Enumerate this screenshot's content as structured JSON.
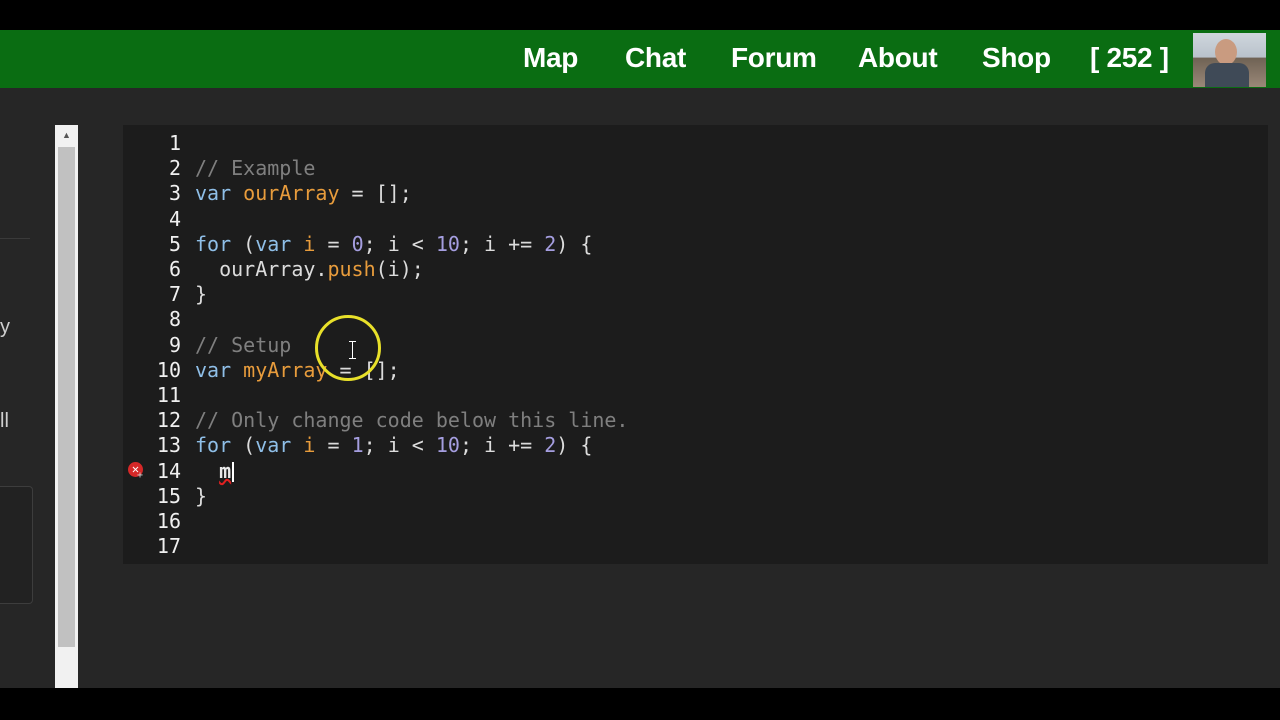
{
  "nav": {
    "links": [
      "Map",
      "Chat",
      "Forum",
      "About",
      "Shop"
    ],
    "points": "[ 252 ]"
  },
  "left_panel": {
    "char1": "y",
    "char2": "ll"
  },
  "editor": {
    "lines": [
      {
        "n": "1",
        "tokens": []
      },
      {
        "n": "2",
        "tokens": [
          {
            "t": "// Example",
            "k": "com"
          }
        ]
      },
      {
        "n": "3",
        "tokens": [
          {
            "t": "var",
            "k": "kw"
          },
          {
            "t": " ",
            "k": "pl"
          },
          {
            "t": "ourArray",
            "k": "var"
          },
          {
            "t": " = [];",
            "k": "pl"
          }
        ]
      },
      {
        "n": "4",
        "tokens": []
      },
      {
        "n": "5",
        "tokens": [
          {
            "t": "for",
            "k": "kw"
          },
          {
            "t": " (",
            "k": "pl"
          },
          {
            "t": "var",
            "k": "kw"
          },
          {
            "t": " ",
            "k": "pl"
          },
          {
            "t": "i",
            "k": "var"
          },
          {
            "t": " = ",
            "k": "pl"
          },
          {
            "t": "0",
            "k": "num"
          },
          {
            "t": "; i < ",
            "k": "pl"
          },
          {
            "t": "10",
            "k": "num"
          },
          {
            "t": "; i += ",
            "k": "pl"
          },
          {
            "t": "2",
            "k": "num"
          },
          {
            "t": ") {",
            "k": "pl"
          }
        ]
      },
      {
        "n": "6",
        "tokens": [
          {
            "t": "  ourArray.",
            "k": "pl"
          },
          {
            "t": "push",
            "k": "var"
          },
          {
            "t": "(i);",
            "k": "pl"
          }
        ]
      },
      {
        "n": "7",
        "tokens": [
          {
            "t": "}",
            "k": "pl"
          }
        ]
      },
      {
        "n": "8",
        "tokens": []
      },
      {
        "n": "9",
        "tokens": [
          {
            "t": "// Setup",
            "k": "com"
          }
        ]
      },
      {
        "n": "10",
        "tokens": [
          {
            "t": "var",
            "k": "kw"
          },
          {
            "t": " ",
            "k": "pl"
          },
          {
            "t": "myArray",
            "k": "var"
          },
          {
            "t": " = [];",
            "k": "pl"
          }
        ]
      },
      {
        "n": "11",
        "tokens": []
      },
      {
        "n": "12",
        "tokens": [
          {
            "t": "// Only change code below this line.",
            "k": "com"
          }
        ]
      },
      {
        "n": "13",
        "tokens": [
          {
            "t": "for",
            "k": "kw"
          },
          {
            "t": " (",
            "k": "pl"
          },
          {
            "t": "var",
            "k": "kw"
          },
          {
            "t": " ",
            "k": "pl"
          },
          {
            "t": "i",
            "k": "var"
          },
          {
            "t": " = ",
            "k": "pl"
          },
          {
            "t": "1",
            "k": "num"
          },
          {
            "t": "; i < ",
            "k": "pl"
          },
          {
            "t": "10",
            "k": "num"
          },
          {
            "t": "; i += ",
            "k": "pl"
          },
          {
            "t": "2",
            "k": "num"
          },
          {
            "t": ") {",
            "k": "pl"
          }
        ]
      },
      {
        "n": "14",
        "tokens": [
          {
            "t": "  ",
            "k": "pl"
          },
          {
            "t": "m",
            "k": "m"
          }
        ],
        "error": true,
        "caret": true
      },
      {
        "n": "15",
        "tokens": [
          {
            "t": "}",
            "k": "pl"
          }
        ]
      },
      {
        "n": "16",
        "tokens": []
      },
      {
        "n": "17",
        "tokens": []
      }
    ]
  },
  "colors": {
    "navbar": "#0a6d12",
    "editor_bg": "#1c1c1c",
    "keyword": "#8fbfe8",
    "variable": "#e89c3c",
    "number": "#a59ee0",
    "comment": "#7f7f7f",
    "error": "#d62828",
    "cursor_ring": "#e8e02a"
  },
  "icons": {
    "error": "error-x-icon",
    "fold": "fold-plus-icon",
    "scroll_up": "scroll-up-arrow-icon"
  }
}
